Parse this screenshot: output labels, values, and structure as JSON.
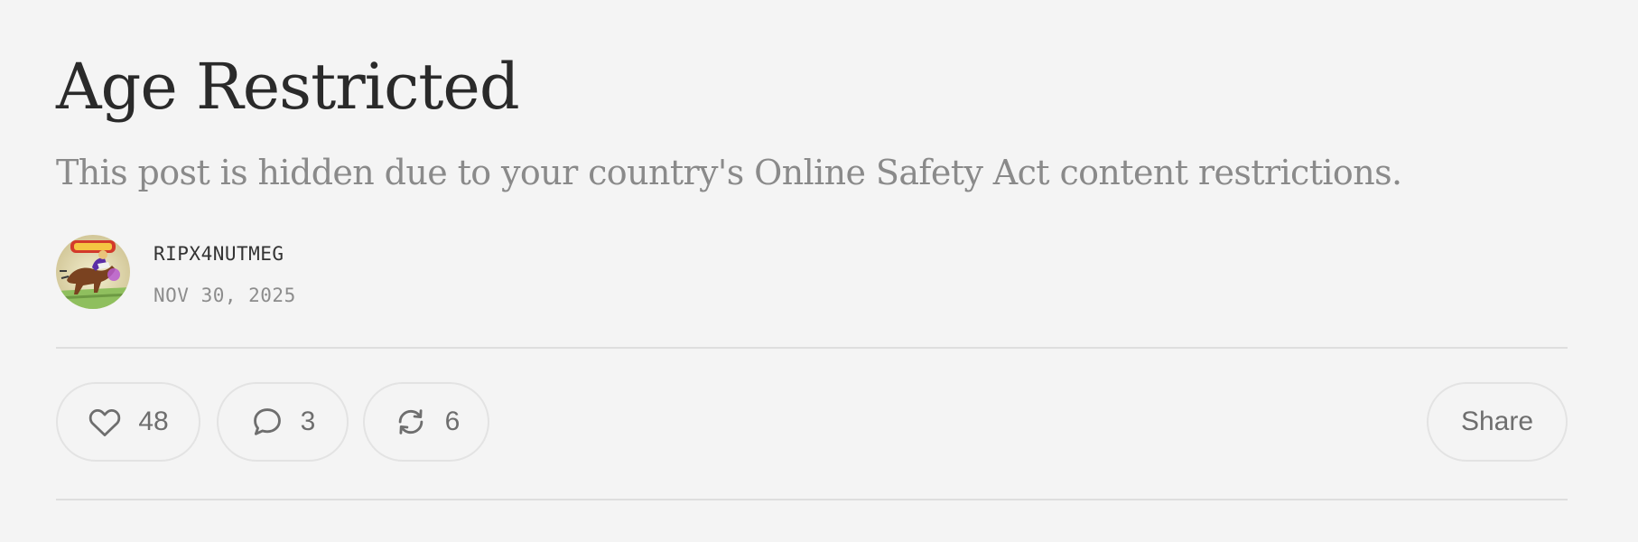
{
  "post": {
    "title": "Age Restricted",
    "subtitle": "This post is hidden due to your country's Online Safety Act content restrictions."
  },
  "byline": {
    "author": "RIPX4NUTMEG",
    "date": "NOV 30, 2025",
    "avatar_icon": "avatar-horse-racing-image"
  },
  "actions": {
    "like": {
      "icon": "heart-icon",
      "count": "48"
    },
    "comment": {
      "icon": "comment-bubble-icon",
      "count": "3"
    },
    "restack": {
      "icon": "restack-arrows-icon",
      "count": "6"
    },
    "share": {
      "label": "Share"
    }
  },
  "colors": {
    "background": "#f4f4f4",
    "title": "#2a2a2a",
    "subtitle": "#8a8a8a",
    "meta": "#8c8c8c",
    "border": "#e3e3e3"
  }
}
